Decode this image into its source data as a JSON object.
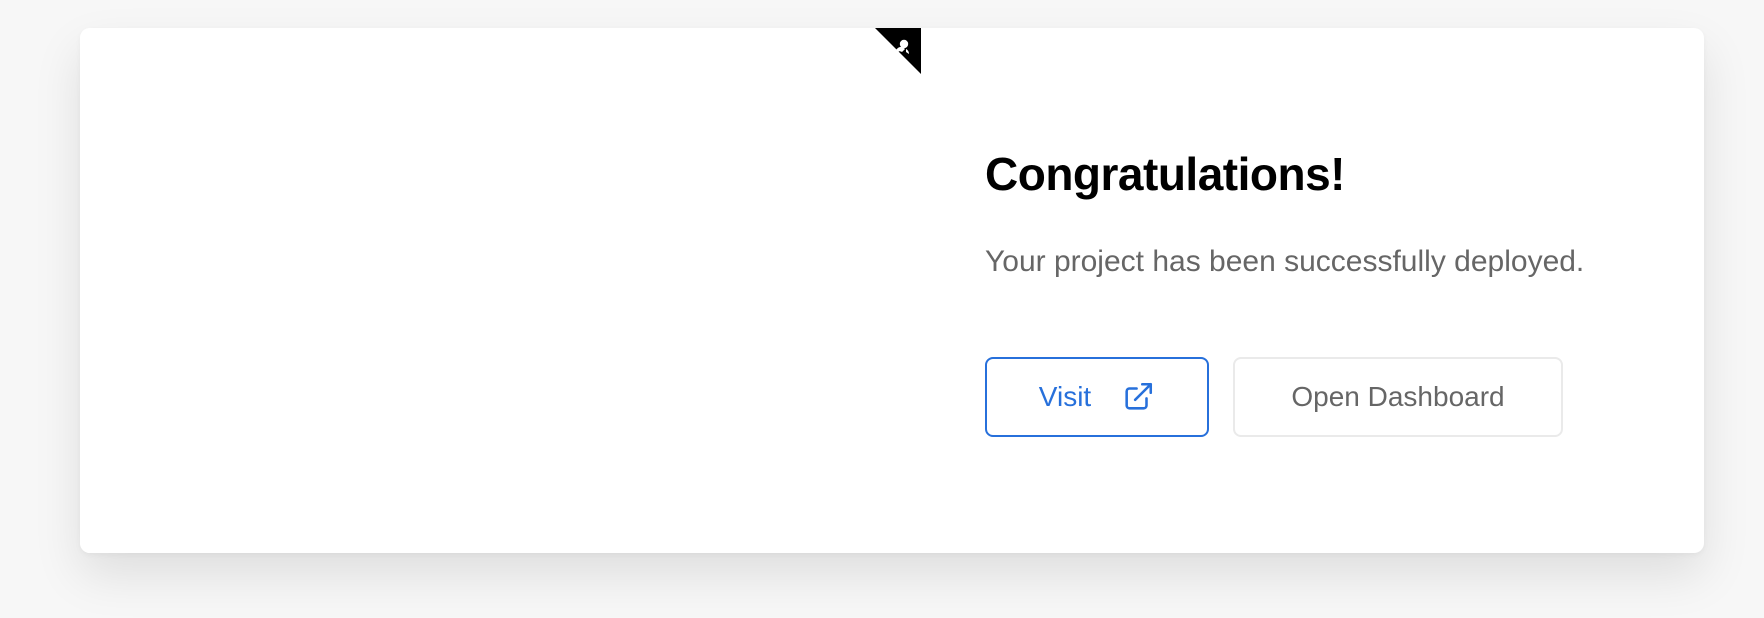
{
  "page": {
    "title": "Congratulations!",
    "subtitle": "Your project has been successfully deployed."
  },
  "actions": {
    "visit_label": "Visit",
    "dashboard_label": "Open Dashboard"
  },
  "colors": {
    "primary": "#2770db",
    "text_primary": "#000000",
    "text_secondary": "#666666",
    "border_muted": "#eaeaea",
    "background": "#f7f7f7"
  },
  "icons": {
    "visit": "external-link-icon",
    "corner": "github-corner-icon"
  }
}
